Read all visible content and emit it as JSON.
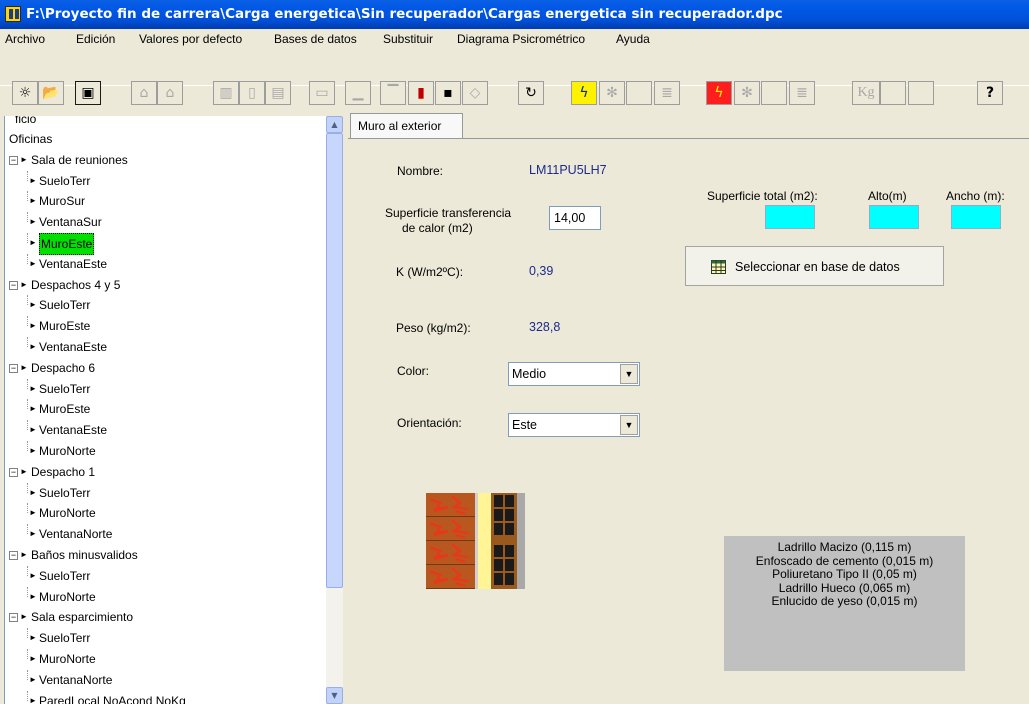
{
  "window": {
    "title": "F:\\Proyecto fin de carrera\\Carga energetica\\Sin recuperador\\Cargas energetica sin recuperador.dpc"
  },
  "menu": [
    "Archivo",
    "Edición",
    "Valores por defecto",
    "Bases de datos",
    "Substituir",
    "Diagrama Psicrométrico",
    "Ayuda"
  ],
  "toolbar": {
    "kg_label": "Kg",
    "help_label": "?"
  },
  "tree": {
    "root_partial": "ficio",
    "building": "Oficinas",
    "groups": [
      {
        "name": "Sala de reuniones",
        "items": [
          "SueloTerr",
          "MuroSur",
          "VentanaSur",
          "MuroEste",
          "VentanaEste"
        ]
      },
      {
        "name": "Despachos 4 y 5",
        "items": [
          "SueloTerr",
          "MuroEste",
          "VentanaEste"
        ]
      },
      {
        "name": "Despacho 6",
        "items": [
          "SueloTerr",
          "MuroEste",
          "VentanaEste",
          "MuroNorte"
        ]
      },
      {
        "name": "Despacho 1",
        "items": [
          "SueloTerr",
          "MuroNorte",
          "VentanaNorte"
        ]
      },
      {
        "name": "Baños minusvalidos",
        "items": [
          "SueloTerr",
          "MuroNorte"
        ]
      },
      {
        "name": "Sala esparcimiento",
        "items": [
          "SueloTerr",
          "MuroNorte",
          "VentanaNorte",
          "ParedLocal NoAcond NoKg"
        ]
      }
    ],
    "selected": "MuroEste"
  },
  "tab": {
    "label": "Muro al exterior"
  },
  "form": {
    "nombre_label": "Nombre:",
    "nombre_value": "LM11PU5LH7",
    "superficie_label_1": "Superficie transferencia",
    "superficie_label_2": "de calor  (m2)",
    "superficie_value": "14,00",
    "k_label": "K (W/m2ºC):",
    "k_value": "0,39",
    "peso_label": "Peso (kg/m2):",
    "peso_value": "328,8",
    "color_label": "Color:",
    "color_value": "Medio",
    "orient_label": "Orientación:",
    "orient_value": "Este",
    "sup_total_label": "Superficie total (m2):",
    "alto_label": "Alto(m)",
    "ancho_label": "Ancho (m):",
    "db_button": "Seleccionar en base de datos"
  },
  "layers": [
    "Ladrillo Macizo (0,115 m)",
    "Enfoscado de cemento (0,015 m)",
    "Poliuretano Tipo II (0,05 m)",
    "Ladrillo Hueco (0,065 m)",
    "Enlucido de yeso (0,015 m)"
  ],
  "colors": {
    "titlebar": "#0054E3",
    "selected_node": "#00E000",
    "dimension_fields": "#00FFFF",
    "value_text": "#1C2A8C",
    "layers_panel": "#C0C0C0"
  }
}
